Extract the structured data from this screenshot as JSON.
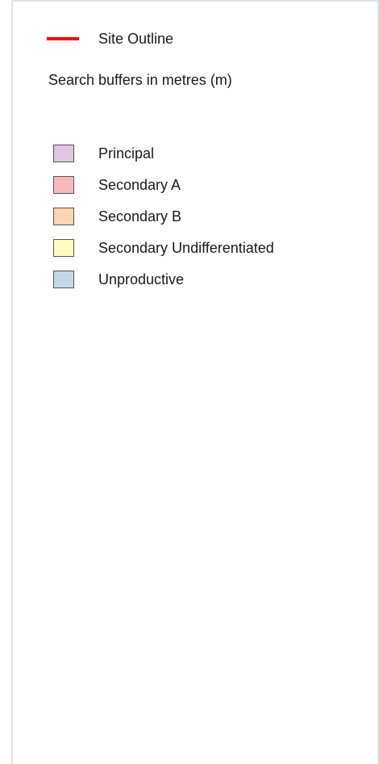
{
  "legend": {
    "site_outline": {
      "label": "Site Outline",
      "color": "#ff0000",
      "icon": "red-line-icon"
    },
    "search_title": "Search buffers in metres (m)",
    "items": [
      {
        "label": "Principal",
        "color": "#dfc6e0"
      },
      {
        "label": "Secondary A",
        "color": "#f5b9bb"
      },
      {
        "label": "Secondary B",
        "color": "#fdd5b0"
      },
      {
        "label": "Secondary Undifferentiated",
        "color": "#fdfcbf"
      },
      {
        "label": "Unproductive",
        "color": "#c5d8e9"
      }
    ]
  }
}
